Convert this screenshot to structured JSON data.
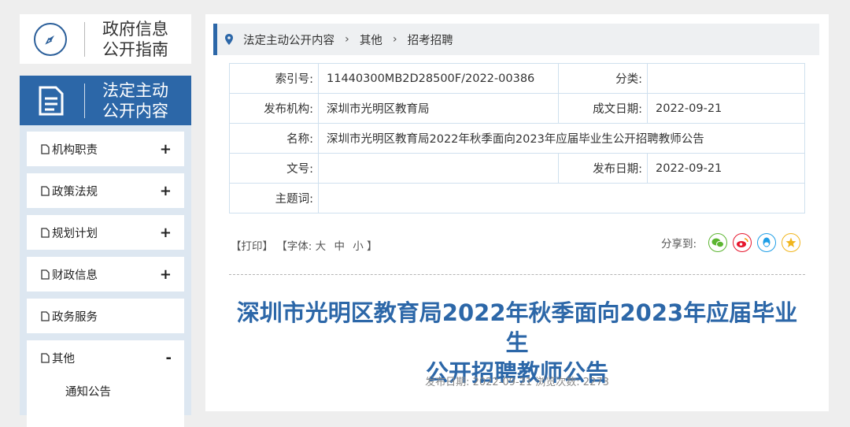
{
  "sidebar": {
    "guide_line1": "政府信息",
    "guide_line2": "公开指南",
    "content_line1": "法定主动",
    "content_line2": "公开内容",
    "items": [
      {
        "label": "机构职责",
        "toggle": "+"
      },
      {
        "label": "政策法规",
        "toggle": "+"
      },
      {
        "label": "规划计划",
        "toggle": "+"
      },
      {
        "label": "财政信息",
        "toggle": "+"
      },
      {
        "label": "政务服务",
        "toggle": ""
      },
      {
        "label": "其他",
        "toggle": "-"
      }
    ],
    "sub_items": [
      "通知公告"
    ]
  },
  "breadcrumb": [
    "法定主动公开内容",
    "其他",
    "招考招聘"
  ],
  "meta": {
    "index_label": "索引号:",
    "index_value": "11440300MB2D28500F/2022-00386",
    "category_label": "分类:",
    "category_value": "",
    "org_label": "发布机构:",
    "org_value": "深圳市光明区教育局",
    "written_label": "成文日期:",
    "written_value": "2022-09-21",
    "name_label": "名称:",
    "name_value": "深圳市光明区教育局2022年秋季面向2023年应届毕业生公开招聘教师公告",
    "docno_label": "文号:",
    "docno_value": "",
    "pub_label": "发布日期:",
    "pub_value": "2022-09-21",
    "topic_label": "主题词:",
    "topic_value": ""
  },
  "tools": {
    "print": "【打印】",
    "font_prefix": "【字体:",
    "large": "大",
    "medium": "中",
    "small": "小",
    "font_suffix": "】",
    "share_label": "分享到:"
  },
  "article": {
    "title_line1": "深圳市光明区教育局2022年秋季面向2023年应届毕业生",
    "title_line2": "公开招聘教师公告",
    "pub_info": "发布日期: 2022-09-21  浏览次数: 2273"
  },
  "colors": {
    "brand_blue": "#2c67a8",
    "wechat": "#5cb531",
    "weibo": "#e6162d",
    "qq": "#1e9ee6",
    "qzone": "#f1b51c"
  }
}
